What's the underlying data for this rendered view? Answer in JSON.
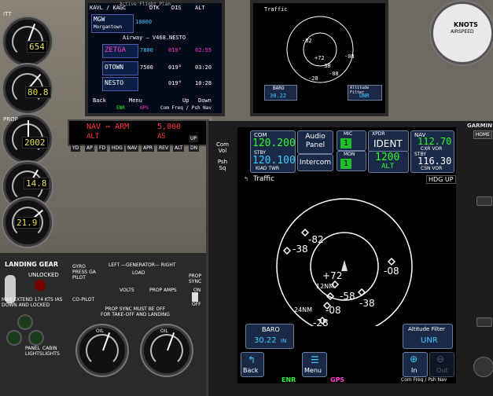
{
  "left_panel": {
    "gauges": [
      {
        "label": "ITT",
        "value": "654"
      },
      {
        "label": "",
        "value": "80.8"
      },
      {
        "label": "PROP",
        "value": "2002"
      },
      {
        "label": "",
        "value": "14.8"
      },
      {
        "label": "",
        "value": "21.9"
      }
    ],
    "nav_display": {
      "line1": "NAV ⇔ ARM",
      "line2": "ALT",
      "alt": "5,000",
      "alt2": "AS"
    },
    "nav_buttons": [
      "YD",
      "AP",
      "FD",
      "HDG",
      "NAV",
      "APR",
      "REV",
      "ALT",
      "UP",
      "DN"
    ]
  },
  "top_mfd": {
    "header": "KAVL / KAGC",
    "cols": [
      "DTK",
      "DIS",
      "ALT"
    ],
    "subtitle": "Active Flight Plan",
    "route_title": "Airway – V468.NESTO",
    "rows": [
      {
        "wpt": "MGW",
        "name": "Morgantown",
        "alt": "10000"
      },
      {
        "wpt": "ZETGA",
        "alt": "7800",
        "dtk": "019°",
        "dis": "02:55"
      },
      {
        "wpt": "OTOWN",
        "alt": "7500",
        "dtk": "019°",
        "dis": "03:20"
      },
      {
        "wpt": "NESTO",
        "alt": "",
        "dtk": "019°",
        "dis": "10:28"
      }
    ],
    "buttons": [
      "Back",
      "Menu",
      "Up",
      "Down"
    ],
    "tabs": [
      "ENR",
      "GPS",
      "Com Freq / Psh Nav"
    ]
  },
  "top_traffic": {
    "title": "Traffic",
    "baro_label": "BARO",
    "baro_value": "30.22",
    "filter_label": "Altitude Filter",
    "filter_value": "UNR",
    "targets": [
      "+72",
      "-38",
      "-82",
      "-08",
      "-28",
      "-08"
    ]
  },
  "lower_panel": {
    "landing_gear": "LANDING GEAR",
    "unlocked": "UNLOCKED",
    "gear_note": "MAX EXTEND 174 KTS IAS\nDOWN AND LOCKED",
    "gyro": "GYRO\nPRESS GA\nPILOT",
    "copilot": "CO-PILOT",
    "generator": "LEFT —GENERATOR— RIGHT",
    "load": "LOAD",
    "volts": "VOLTS",
    "prop_amps": "PROP AMPS",
    "prop_sync": "PROP\nSYNC",
    "on": "ON",
    "off": "OFF",
    "prop_sync_note": "PROP SYNC MUST BE OFF\nFOR TAKE-OFF AND LANDING",
    "panel_lights": "PANEL\nLIGHTS",
    "cabin_lights": "CABIN\nLIGHTS",
    "oil": "OIL"
  },
  "gtn": {
    "brand": "GARMIN",
    "home": "HOME",
    "side_top": "Com\nVol",
    "side_bottom": "Psh\nSq",
    "com_label": "COM",
    "com_active": "120.200",
    "com_stby_label": "STBY",
    "com_stby": "120.100",
    "com_stby_id": "KIAD TWR",
    "audio_panel": "Audio\nPanel",
    "intercom": "Intercom",
    "mic_label": "MIC",
    "mic_value": "1",
    "mon_label": "MON",
    "mon_value": "1",
    "xpdr_label": "XPDR",
    "ident": "IDENT",
    "xpdr_code": "1200",
    "xpdr_mode": "ALT",
    "nav_label": "NAV",
    "nav_active": "112.70",
    "nav_active_id": "CXR VOR",
    "nav_stby_label": "STBY",
    "nav_stby": "116.30",
    "nav_stby_id": "CSN VOR",
    "page_title": "Traffic",
    "heading_mode": "HDG UP",
    "range_labels": [
      "12NM",
      "24NM"
    ],
    "targets": [
      {
        "label": "-82"
      },
      {
        "label": "-38"
      },
      {
        "label": "+72"
      },
      {
        "label": "-08"
      },
      {
        "label": "-58"
      },
      {
        "label": "-38"
      },
      {
        "label": "-08"
      },
      {
        "label": "-28"
      }
    ],
    "baro_label": "BARO",
    "baro_value": "30.22",
    "baro_unit": "IN",
    "filter_label": "Altitude Filter",
    "filter_value": "UNR",
    "back_label": "Back",
    "menu_label": "Menu",
    "in_label": "In",
    "out_label": "Out",
    "status_enr": "ENR",
    "status_gps": "GPS",
    "status_right": "Com Freq / Psh Nav"
  },
  "airspeed": {
    "label": "KNOTS",
    "sub": "AIRSPEED"
  },
  "colors": {
    "active_freq": "#2ef52e",
    "standby": "#3ec8ff",
    "enr": "#2ef52e",
    "gps": "#ff3ad0"
  }
}
